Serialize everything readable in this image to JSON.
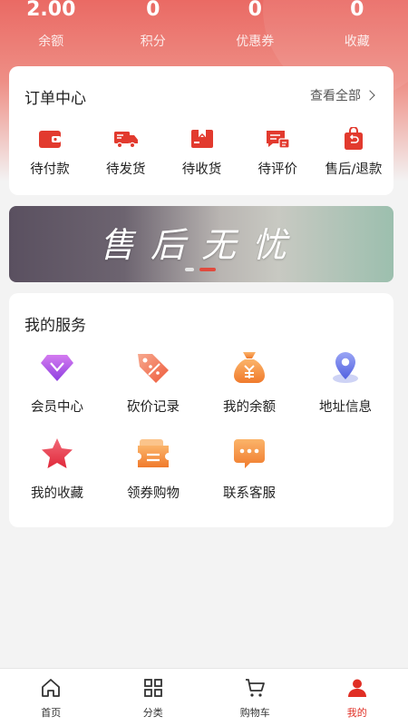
{
  "colors": {
    "accent": "#e02e24",
    "header": "#ea6a64",
    "banner_dot_active": "#e04a3e"
  },
  "stats": [
    {
      "value": "2.00",
      "label": "余额"
    },
    {
      "value": "0",
      "label": "积分"
    },
    {
      "value": "0",
      "label": "优惠券"
    },
    {
      "value": "0",
      "label": "收藏"
    }
  ],
  "orders": {
    "title": "订单中心",
    "view_all": "查看全部",
    "items": [
      {
        "label": "待付款",
        "icon": "wallet-icon"
      },
      {
        "label": "待发货",
        "icon": "truck-icon"
      },
      {
        "label": "待收货",
        "icon": "box-icon"
      },
      {
        "label": "待评价",
        "icon": "comment-icon"
      },
      {
        "label": "售后/退款",
        "icon": "refund-bag-icon"
      }
    ]
  },
  "banner": {
    "text": "售后无忧",
    "slide_count": 2,
    "active_slide": 2
  },
  "services": {
    "title": "我的服务",
    "items": [
      {
        "label": "会员中心",
        "icon": "diamond-icon"
      },
      {
        "label": "砍价记录",
        "icon": "discount-tag-icon"
      },
      {
        "label": "我的余额",
        "icon": "money-bag-icon"
      },
      {
        "label": "地址信息",
        "icon": "location-pin-icon"
      },
      {
        "label": "我的收藏",
        "icon": "star-icon"
      },
      {
        "label": "领券购物",
        "icon": "coupon-icon"
      },
      {
        "label": "联系客服",
        "icon": "chat-bubble-icon"
      }
    ]
  },
  "tabbar": {
    "items": [
      {
        "label": "首页",
        "icon": "home-icon"
      },
      {
        "label": "分类",
        "icon": "grid-icon"
      },
      {
        "label": "购物车",
        "icon": "cart-icon"
      },
      {
        "label": "我的",
        "icon": "user-icon",
        "active": true
      }
    ]
  }
}
